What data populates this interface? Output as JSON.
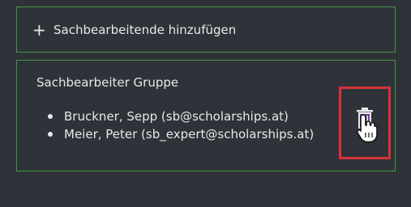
{
  "add_panel": {
    "icon": "plus-icon",
    "plus_glyph": "+",
    "label": "Sachbearbeitende hinzufügen"
  },
  "group_panel": {
    "title": "Sachbearbeiter Gruppe",
    "members": [
      {
        "text": "Bruckner, Sepp (sb@scholarships.at)"
      },
      {
        "text": "Meier, Peter (sb_expert@scholarships.at)"
      }
    ],
    "delete_icon": "trash-icon",
    "cursor_icon": "hand-pointer-icon"
  },
  "colors": {
    "background": "#2f3238",
    "panel_border": "#3f9a3f",
    "text": "#e7e8ea",
    "highlight": "#d9323a",
    "trash_icon": "#7a3ca0"
  }
}
